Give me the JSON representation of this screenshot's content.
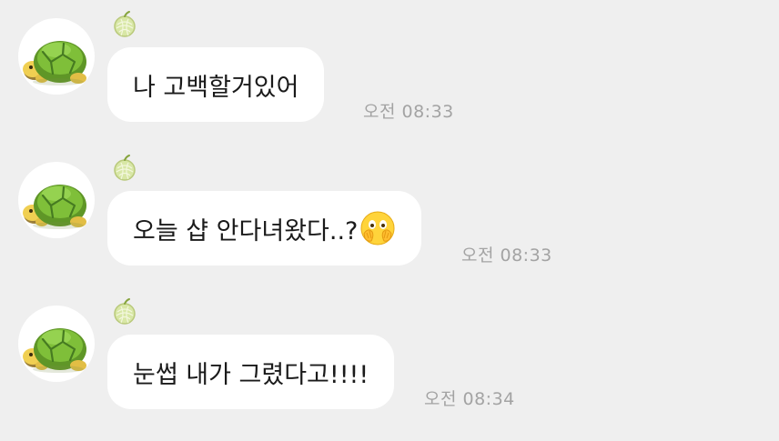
{
  "messages": [
    {
      "text": "나 고백할거있어",
      "time": "오전 08:33",
      "emoji": ""
    },
    {
      "text": "오늘 샵 안다녀왔다..?",
      "time": "오전 08:33",
      "emoji": "face-with-hands-over-eyes-emoji"
    },
    {
      "text": "눈썹 내가 그렸다고!!!!",
      "time": "오전 08:34",
      "emoji": ""
    }
  ],
  "icons": {
    "avatar": "turtle-avatar",
    "sender_badge": "melon-icon"
  },
  "colors": {
    "background": "#efefef",
    "bubble": "#ffffff",
    "text": "#1a1a1a",
    "timestamp": "#a3a3a3"
  }
}
